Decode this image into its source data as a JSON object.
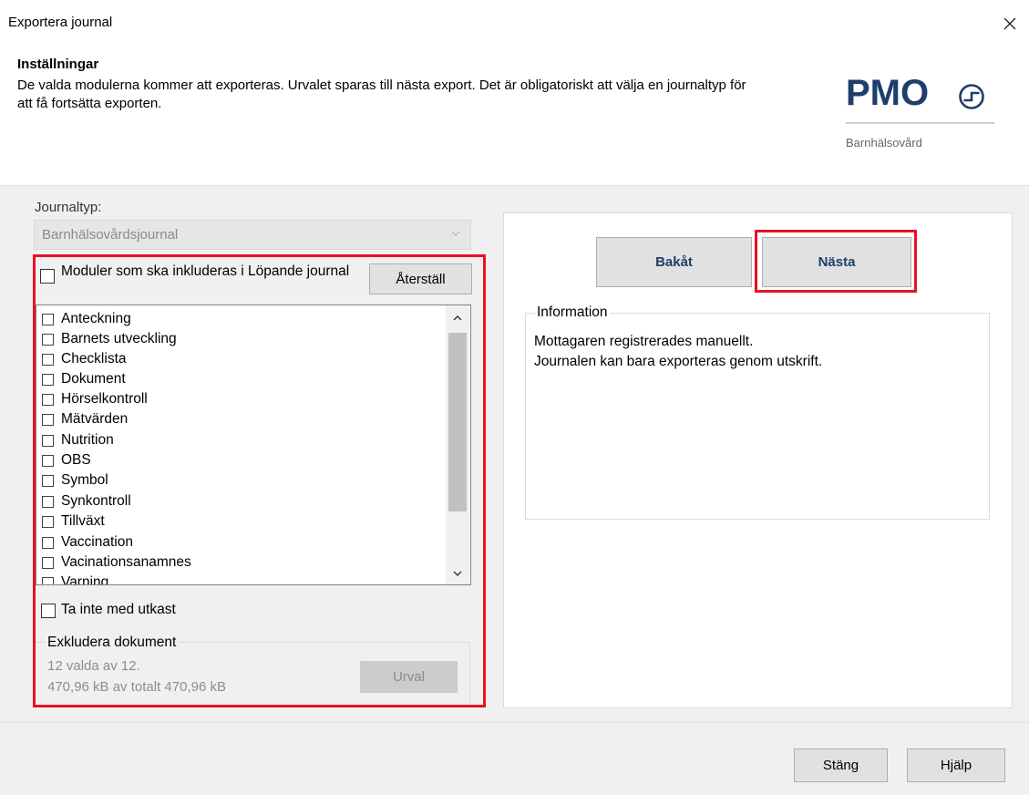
{
  "window": {
    "title": "Exportera journal"
  },
  "header": {
    "settings_title": "Inställningar",
    "description": "De valda modulerna kommer att exporteras. Urvalet sparas till nästa export. Det är obligatoriskt att välja en journaltyp för att få fortsätta exporten."
  },
  "logo": {
    "text": "PMO",
    "subtitle": "Barnhälsovård",
    "color": "#1e3e6b",
    "icon": "power-circle-icon"
  },
  "journaltyp": {
    "label": "Journaltyp:",
    "value": "Barnhälsovårdsjournal"
  },
  "modules": {
    "label": "Moduler som ska inkluderas i Löpande journal",
    "reset_label": "Återställ",
    "items": [
      "Anteckning",
      "Barnets utveckling",
      "Checklista",
      "Dokument",
      "Hörselkontroll",
      "Mätvärden",
      "Nutrition",
      "OBS",
      "Symbol",
      "Synkontroll",
      "Tillväxt",
      "Vaccination",
      "Vacinationsanamnes",
      "Varning"
    ]
  },
  "draft": {
    "label": "Ta inte med utkast"
  },
  "exclude": {
    "title": "Exkludera dokument",
    "line1": "12 valda av 12.",
    "line2": "470,96 kB av totalt 470,96 kB",
    "button": "Urval"
  },
  "nav": {
    "back_label": "Bakåt",
    "next_label": "Nästa"
  },
  "info": {
    "title": "Information",
    "line1": "Mottagaren registrerades manuellt.",
    "line2": "Journalen kan bara exporteras genom utskrift."
  },
  "footer": {
    "close_label": "Stäng",
    "help_label": "Hjälp"
  },
  "colors": {
    "highlight": "#e81123",
    "brand": "#1e3e6b"
  }
}
